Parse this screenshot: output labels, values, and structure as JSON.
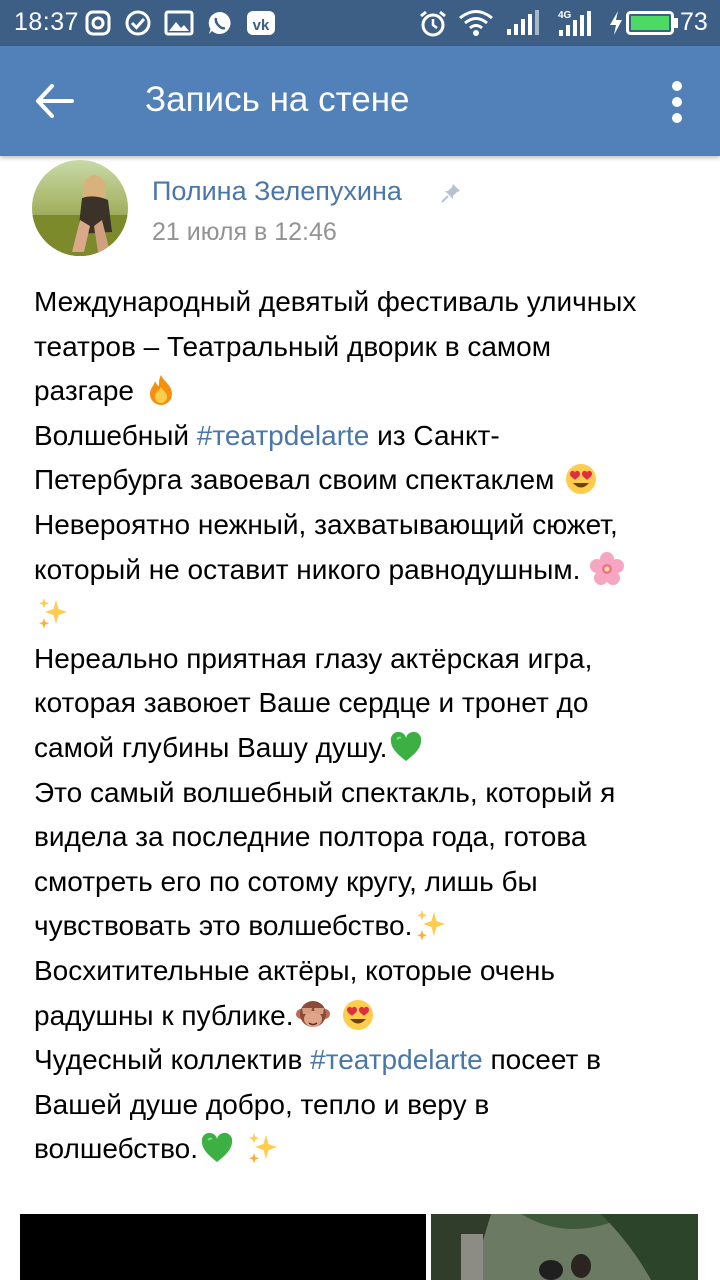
{
  "status_bar": {
    "time": "18:37",
    "network_label": "4G",
    "battery": "73",
    "icons": [
      "instagram-icon",
      "check-circle-icon",
      "gallery-icon",
      "whatsapp-icon",
      "vk-icon",
      "alarm-icon",
      "wifi-icon",
      "signal-icon",
      "signal-4g-icon",
      "charging-icon",
      "battery-icon"
    ]
  },
  "header": {
    "title": "Запись на стене",
    "back_icon": "arrow-back-icon",
    "menu_icon": "more-vertical-icon",
    "background": "#5181b8"
  },
  "post": {
    "author": "Полина Зелепухина",
    "date": "21 июля в 12:46",
    "pinned_icon": "pin-icon",
    "lines": [
      {
        "parts": [
          {
            "type": "text",
            "value": "Международный девятый фестиваль уличных"
          }
        ]
      },
      {
        "parts": [
          {
            "type": "text",
            "value": "театров – Театральный дворик в самом"
          }
        ]
      },
      {
        "parts": [
          {
            "type": "text",
            "value": "разгаре "
          },
          {
            "type": "emoji",
            "value": "fire-emoji"
          }
        ]
      },
      {
        "parts": [
          {
            "type": "text",
            "value": "Волшебный  "
          },
          {
            "type": "hashtag",
            "value": "#театрdelarte"
          },
          {
            "type": "text",
            "value": " из Санкт-"
          }
        ]
      },
      {
        "parts": [
          {
            "type": "text",
            "value": "Петербурга завоевал своим спектаклем "
          },
          {
            "type": "emoji",
            "value": "heart-eyes-emoji"
          }
        ]
      },
      {
        "parts": [
          {
            "type": "text",
            "value": "Невероятно нежный, захватывающий сюжет,"
          }
        ]
      },
      {
        "parts": [
          {
            "type": "text",
            "value": "который не оставит никого равнодушным. "
          },
          {
            "type": "emoji",
            "value": "cherry-blossom-emoji"
          }
        ]
      },
      {
        "parts": [
          {
            "type": "emoji",
            "value": "sparkles-emoji"
          }
        ]
      },
      {
        "parts": [
          {
            "type": "text",
            "value": "Нереально приятная глазу актёрская игра,"
          }
        ]
      },
      {
        "parts": [
          {
            "type": "text",
            "value": "которая завоюет Ваше сердце и тронет до"
          }
        ]
      },
      {
        "parts": [
          {
            "type": "text",
            "value": "самой глубины Вашу душу."
          },
          {
            "type": "emoji",
            "value": "green-heart-emoji"
          }
        ]
      },
      {
        "parts": [
          {
            "type": "text",
            "value": "Это самый волшебный спектакль, который я"
          }
        ]
      },
      {
        "parts": [
          {
            "type": "text",
            "value": "видела за последние полтора года, готова"
          }
        ]
      },
      {
        "parts": [
          {
            "type": "text",
            "value": "смотреть его по сотому кругу, лишь бы"
          }
        ]
      },
      {
        "parts": [
          {
            "type": "text",
            "value": "чувствовать это волшебство."
          },
          {
            "type": "emoji",
            "value": "sparkles-emoji"
          }
        ]
      },
      {
        "parts": [
          {
            "type": "text",
            "value": "Восхитительные актёры, которые очень"
          }
        ]
      },
      {
        "parts": [
          {
            "type": "text",
            "value": "радушны к публике."
          },
          {
            "type": "emoji",
            "value": "see-no-evil-monkey-emoji"
          },
          {
            "type": "text",
            "value": " "
          },
          {
            "type": "emoji",
            "value": "heart-eyes-emoji"
          }
        ]
      },
      {
        "parts": [
          {
            "type": "text",
            "value": "Чудесный коллектив "
          },
          {
            "type": "hashtag",
            "value": "#театрdelarte"
          },
          {
            "type": "text",
            "value": " посеет в"
          }
        ]
      },
      {
        "parts": [
          {
            "type": "text",
            "value": "Вашей душе добро, тепло и веру в"
          }
        ]
      },
      {
        "parts": [
          {
            "type": "text",
            "value": "волшебство."
          },
          {
            "type": "emoji",
            "value": "green-heart-emoji"
          },
          {
            "type": "text",
            "value": " "
          },
          {
            "type": "emoji",
            "value": "sparkles-emoji"
          }
        ]
      }
    ],
    "colors": {
      "link": "#4a76a8",
      "date": "#939393",
      "text": "#000000"
    }
  }
}
